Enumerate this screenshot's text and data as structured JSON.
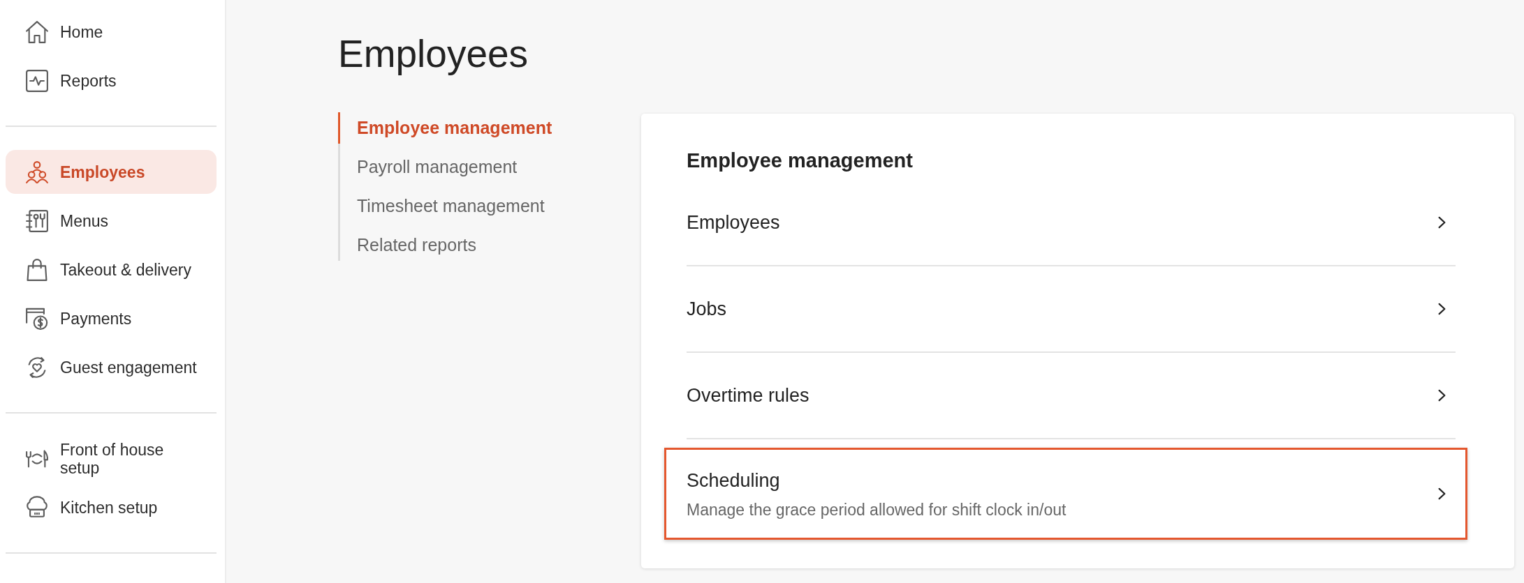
{
  "sidebar": {
    "groups": [
      {
        "items": [
          {
            "label": "Home",
            "selected": false
          },
          {
            "label": "Reports",
            "selected": false
          }
        ]
      },
      {
        "items": [
          {
            "label": "Employees",
            "selected": true
          },
          {
            "label": "Menus",
            "selected": false
          },
          {
            "label": "Takeout & delivery",
            "selected": false
          },
          {
            "label": "Payments",
            "selected": false
          },
          {
            "label": "Guest engagement",
            "selected": false
          }
        ]
      },
      {
        "items": [
          {
            "label": "Front of house setup",
            "selected": false
          },
          {
            "label": "Kitchen setup",
            "selected": false
          }
        ]
      }
    ]
  },
  "page": {
    "title": "Employees"
  },
  "section_nav": {
    "items": [
      {
        "label": "Employee management",
        "selected": true
      },
      {
        "label": "Payroll management",
        "selected": false
      },
      {
        "label": "Timesheet management",
        "selected": false
      },
      {
        "label": "Related reports",
        "selected": false
      }
    ]
  },
  "card": {
    "title": "Employee management",
    "items": [
      {
        "title": "Employees",
        "highlighted": false
      },
      {
        "title": "Jobs",
        "highlighted": false
      },
      {
        "title": "Overtime rules",
        "highlighted": false
      },
      {
        "title": "Scheduling",
        "description": "Manage the grace period allowed for shift clock in/out",
        "highlighted": true
      }
    ]
  }
}
